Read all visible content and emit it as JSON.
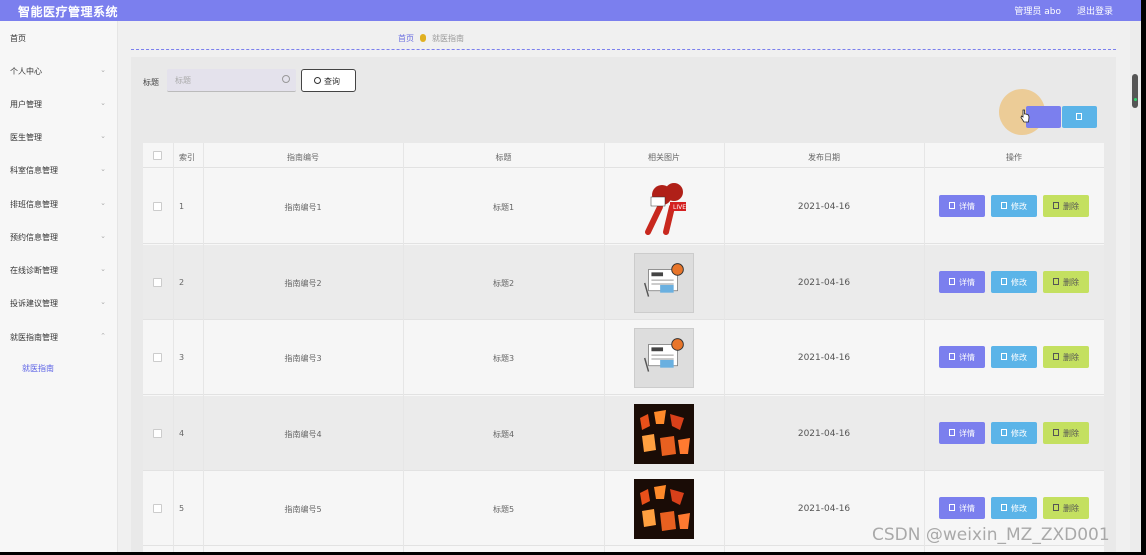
{
  "app": {
    "title": "智能医疗管理系统",
    "admin_label": "管理员 abo",
    "logout_label": "退出登录"
  },
  "sidebar": {
    "items": [
      {
        "label": "首页",
        "has_arrow": false
      },
      {
        "label": "个人中心",
        "has_arrow": true
      },
      {
        "label": "用户管理",
        "has_arrow": true
      },
      {
        "label": "医生管理",
        "has_arrow": true
      },
      {
        "label": "科室信息管理",
        "has_arrow": true
      },
      {
        "label": "排班信息管理",
        "has_arrow": true
      },
      {
        "label": "预约信息管理",
        "has_arrow": true
      },
      {
        "label": "在线诊断管理",
        "has_arrow": true
      },
      {
        "label": "投诉建议管理",
        "has_arrow": true
      },
      {
        "label": "就医指南管理",
        "has_arrow": true
      }
    ],
    "sub_item": "就医指南"
  },
  "breadcrumb": {
    "home": "首页",
    "current": "就医指南"
  },
  "search": {
    "label": "标题",
    "placeholder": "标题",
    "button_label": "查询"
  },
  "table": {
    "headers": [
      "索引",
      "指南编号",
      "标题",
      "相关图片",
      "发布日期",
      "操作"
    ],
    "rows": [
      {
        "index": "1",
        "code": "指南编号1",
        "title": "标题1",
        "image": "microphone-image",
        "date": "2021-04-16"
      },
      {
        "index": "2",
        "code": "指南编号2",
        "title": "标题2",
        "image": "news-image",
        "date": "2021-04-16"
      },
      {
        "index": "3",
        "code": "指南编号3",
        "title": "标题3",
        "image": "news-image",
        "date": "2021-04-16"
      },
      {
        "index": "4",
        "code": "指南编号4",
        "title": "标题4",
        "image": "neon-sign-image",
        "date": "2021-04-16"
      },
      {
        "index": "5",
        "code": "指南编号5",
        "title": "标题5",
        "image": "neon-sign-image",
        "date": "2021-04-16"
      }
    ],
    "actions": {
      "detail": "详情",
      "edit": "修改",
      "remove": "删除"
    }
  },
  "watermark": "CSDN @weixin_MZ_ZXD001",
  "colors": {
    "topbar": "#7b7fee",
    "detail": "#7b7fee",
    "edit": "#5bb4e8",
    "remove": "#c4e060",
    "active_link": "#5b62e6"
  }
}
